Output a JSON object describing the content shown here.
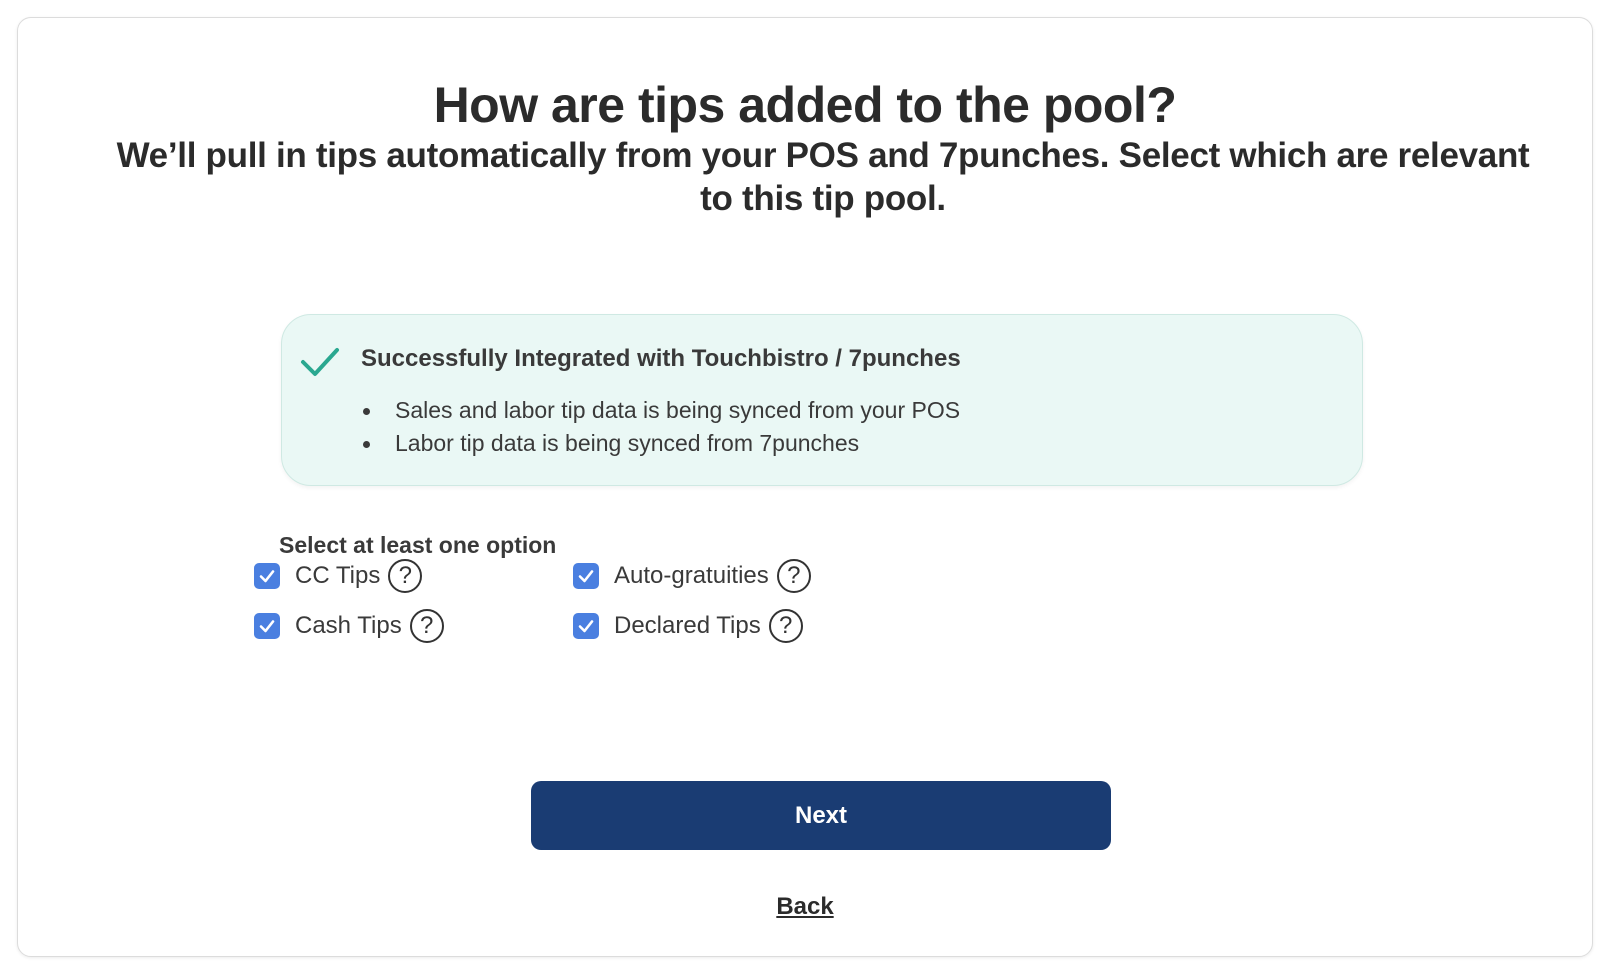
{
  "header": {
    "title": "How are tips added to the pool?",
    "subtitle": "We’ll pull in tips automatically from your POS and 7punches. Select which are relevant to this tip pool."
  },
  "integration": {
    "icon": "check-icon",
    "title": "Successfully Integrated with Touchbistro / 7punches",
    "bullets": [
      "Sales and labor tip data is being synced from your POS",
      "Labor tip data is being synced from 7punches"
    ],
    "colors": {
      "background": "#eaf8f5",
      "check": "#2aa890"
    }
  },
  "options": {
    "label": "Select at least one option",
    "items": [
      {
        "label": "CC Tips",
        "checked": true,
        "help": "?"
      },
      {
        "label": "Auto-gratuities",
        "checked": true,
        "help": "?"
      },
      {
        "label": "Cash Tips",
        "checked": true,
        "help": "?"
      },
      {
        "label": "Declared Tips",
        "checked": true,
        "help": "?"
      }
    ],
    "colors": {
      "checkbox": "#4a7fe0"
    }
  },
  "actions": {
    "next_label": "Next",
    "back_label": "Back",
    "colors": {
      "primary": "#1a3c73"
    }
  }
}
